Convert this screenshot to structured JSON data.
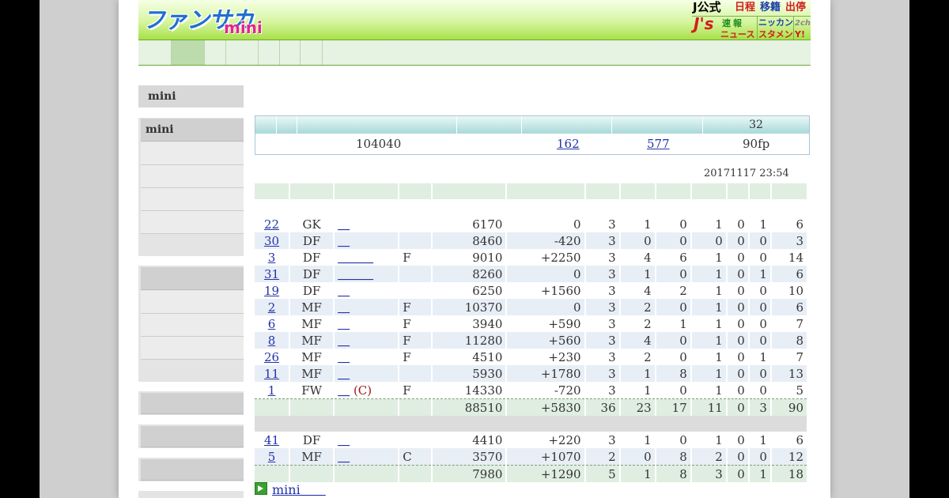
{
  "header": {
    "logo_main": "ファンサカ",
    "logo_mini": "mini",
    "links": {
      "j_official": "J公式",
      "schedule": "日程",
      "transfer": "移籍",
      "suspension": "出停",
      "js": "J's",
      "sokuho": "速報",
      "news": "ニュース",
      "nikkan": "ニッカン",
      "twoch": "2ch",
      "starting": "スタメン",
      "yahoo": "Y!"
    }
  },
  "sidebar": {
    "block1_title": "mini",
    "block2_title": "mini"
  },
  "summary": {
    "head_last": "32",
    "value1": "104040",
    "link1": "162",
    "link2": "577",
    "points": "90fp"
  },
  "updated": "20171117 23:54",
  "players": [
    {
      "no": "22",
      "pos": "GK",
      "name": "＿",
      "capt": "",
      "f": "",
      "price": "6170",
      "diff": "0",
      "a": "3",
      "b": "1",
      "c": "0",
      "d": "1",
      "e": "0",
      "g": "1",
      "pts": "6"
    },
    {
      "no": "30",
      "pos": "DF",
      "name": "＿",
      "capt": "",
      "f": "",
      "price": "8460",
      "diff": "-420",
      "a": "3",
      "b": "0",
      "c": "0",
      "d": "0",
      "e": "0",
      "g": "0",
      "pts": "3"
    },
    {
      "no": "3",
      "pos": "DF",
      "name": "＿＿＿",
      "capt": "",
      "f": "F",
      "price": "9010",
      "diff": "+2250",
      "a": "3",
      "b": "4",
      "c": "6",
      "d": "1",
      "e": "0",
      "g": "0",
      "pts": "14"
    },
    {
      "no": "31",
      "pos": "DF",
      "name": "＿＿＿",
      "capt": "",
      "f": "",
      "price": "8260",
      "diff": "0",
      "a": "3",
      "b": "1",
      "c": "0",
      "d": "1",
      "e": "0",
      "g": "1",
      "pts": "6"
    },
    {
      "no": "19",
      "pos": "DF",
      "name": "＿",
      "capt": "",
      "f": "",
      "price": "6250",
      "diff": "+1560",
      "a": "3",
      "b": "4",
      "c": "2",
      "d": "1",
      "e": "0",
      "g": "0",
      "pts": "10"
    },
    {
      "no": "2",
      "pos": "MF",
      "name": "＿",
      "capt": "",
      "f": "F",
      "price": "10370",
      "diff": "0",
      "a": "3",
      "b": "2",
      "c": "0",
      "d": "1",
      "e": "0",
      "g": "0",
      "pts": "6"
    },
    {
      "no": "6",
      "pos": "MF",
      "name": "＿",
      "capt": "",
      "f": "F",
      "price": "3940",
      "diff": "+590",
      "a": "3",
      "b": "2",
      "c": "1",
      "d": "1",
      "e": "0",
      "g": "0",
      "pts": "7"
    },
    {
      "no": "8",
      "pos": "MF",
      "name": "＿",
      "capt": "",
      "f": "F",
      "price": "11280",
      "diff": "+560",
      "a": "3",
      "b": "4",
      "c": "0",
      "d": "1",
      "e": "0",
      "g": "0",
      "pts": "8"
    },
    {
      "no": "26",
      "pos": "MF",
      "name": "＿",
      "capt": "",
      "f": "F",
      "price": "4510",
      "diff": "+230",
      "a": "3",
      "b": "2",
      "c": "0",
      "d": "1",
      "e": "0",
      "g": "1",
      "pts": "7"
    },
    {
      "no": "11",
      "pos": "MF",
      "name": "＿",
      "capt": "",
      "f": "",
      "price": "5930",
      "diff": "+1780",
      "a": "3",
      "b": "1",
      "c": "8",
      "d": "1",
      "e": "0",
      "g": "0",
      "pts": "13"
    },
    {
      "no": "1",
      "pos": "FW",
      "name": "＿",
      "capt": "(C)",
      "f": "F",
      "price": "14330",
      "diff": "-720",
      "a": "3",
      "b": "1",
      "c": "0",
      "d": "1",
      "e": "0",
      "g": "0",
      "pts": "5"
    }
  ],
  "total1": {
    "price": "88510",
    "diff": "+5830",
    "a": "36",
    "b": "23",
    "c": "17",
    "d": "11",
    "e": "0",
    "g": "3",
    "pts": "90"
  },
  "subs": [
    {
      "no": "41",
      "pos": "DF",
      "name": "＿",
      "capt": "",
      "f": "",
      "price": "4410",
      "diff": "+220",
      "a": "3",
      "b": "1",
      "c": "0",
      "d": "1",
      "e": "0",
      "g": "1",
      "pts": "6"
    },
    {
      "no": "5",
      "pos": "MF",
      "name": "＿",
      "capt": "",
      "f": "C",
      "price": "3570",
      "diff": "+1070",
      "a": "2",
      "b": "0",
      "c": "8",
      "d": "2",
      "e": "0",
      "g": "0",
      "pts": "12"
    }
  ],
  "total2": {
    "price": "7980",
    "diff": "+1290",
    "a": "5",
    "b": "1",
    "c": "8",
    "d": "3",
    "e": "0",
    "g": "1",
    "pts": "18"
  },
  "footer": {
    "link": "mini＿＿",
    "icon": "arrow-right-icon"
  },
  "colors": {
    "header_green": "#a8e048",
    "link_blue": "#2233aa",
    "table_head": "#dfeee0",
    "row_alt": "#e8eef6"
  }
}
